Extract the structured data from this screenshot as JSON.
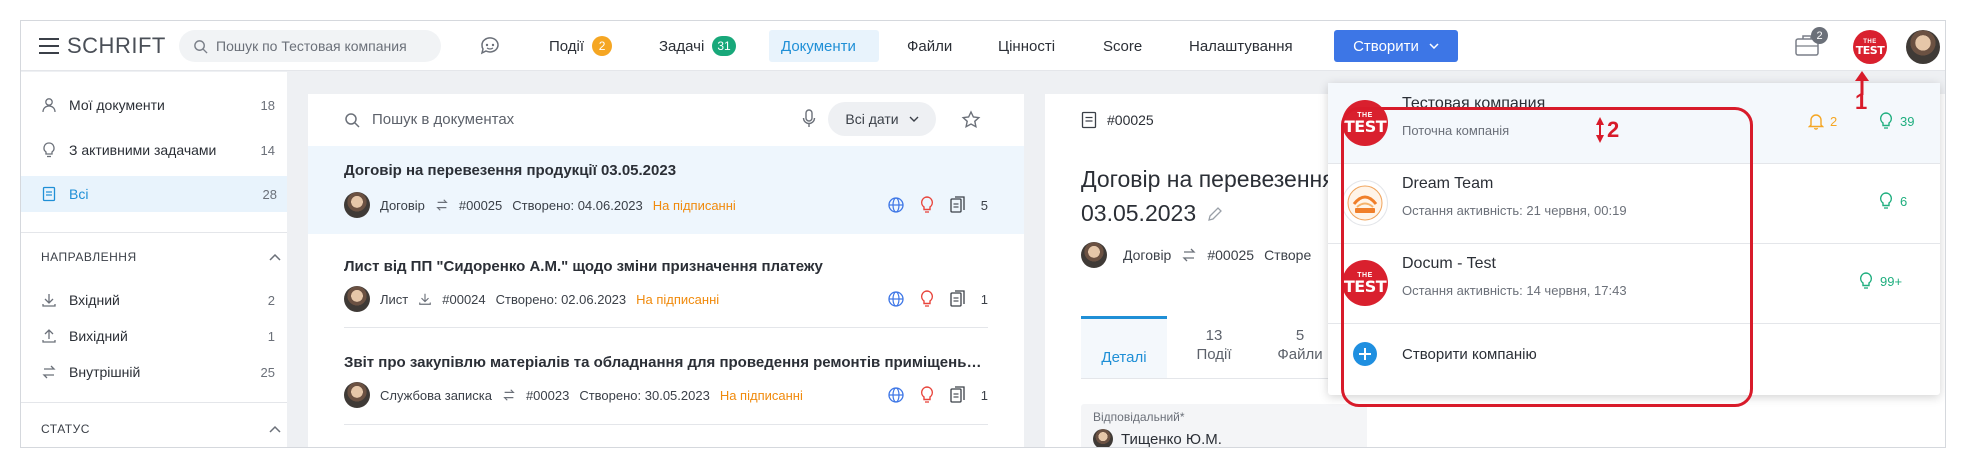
{
  "colors": {
    "accent": "#1f8fd6",
    "primary_button": "#3d76e6",
    "events_badge": "#f5a623",
    "tasks_badge": "#18a87a",
    "status_pending": "#f08a0c",
    "annotation": "#d81b2a",
    "bell": "#f5a623",
    "bulb": "#1eae7e"
  },
  "header": {
    "logo_text": "SCHRIFT",
    "search_placeholder": "Пошук по Тестовая компания",
    "nav": [
      {
        "label": "Події",
        "badge": "2",
        "active": false
      },
      {
        "label": "Задачі",
        "badge": "31",
        "active": false
      },
      {
        "label": "Документи",
        "badge": "",
        "active": true
      },
      {
        "label": "Файли",
        "badge": "",
        "active": false
      },
      {
        "label": "Цінності",
        "badge": "",
        "active": false
      },
      {
        "label": "Score",
        "badge": "",
        "active": false
      },
      {
        "label": "Налаштування",
        "badge": "",
        "active": false
      }
    ],
    "create_label": "Створити",
    "briefcase_badge": "2",
    "company_avatar_top": "THE",
    "company_avatar_main": "TEST"
  },
  "sidebar": {
    "items": [
      {
        "label": "Мої документи",
        "count": "18",
        "icon": "person-icon"
      },
      {
        "label": "З активними задачами",
        "count": "14",
        "icon": "bulb-icon"
      },
      {
        "label": "Всі",
        "count": "28",
        "icon": "document-icon"
      }
    ],
    "direction_heading": "НАПРАВЛЕННЯ",
    "direction_items": [
      {
        "label": "Вхідний",
        "count": "2",
        "icon": "download-icon"
      },
      {
        "label": "Вихідний",
        "count": "1",
        "icon": "upload-icon"
      },
      {
        "label": "Внутрішній",
        "count": "25",
        "icon": "swap-icon"
      }
    ],
    "status_heading": "СТАТУС"
  },
  "doclist": {
    "search_placeholder": "Пошук в документах",
    "date_filter": "Всі дати",
    "rows": [
      {
        "title": "Договір на перевезення продукції 03.05.2023",
        "type": "Договір",
        "number": "#00025",
        "created": "Створено: 04.06.2023",
        "status": "На підписанні",
        "files": "5"
      },
      {
        "title": "Лист від ПП \"Сидоренко А.М.\" щодо зміни призначення платежу",
        "type": "Лист",
        "number": "#00024",
        "created": "Створено: 02.06.2023",
        "status": "На підписанні",
        "files": "1"
      },
      {
        "title": "Звіт про закупівлю матеріалів та обладнання для проведення ремонтів приміщень …",
        "type": "Службова записка",
        "number": "#00023",
        "created": "Створено: 30.05.2023",
        "status": "На підписанні",
        "files": "1"
      }
    ]
  },
  "detail": {
    "number": "#00025",
    "title_line1": "Договір на перевезення",
    "title_line2": "03.05.2023",
    "type": "Договір",
    "doc_number": "#00025",
    "created_partial": "Створе",
    "tabs": [
      {
        "count": "",
        "label": "Деталі"
      },
      {
        "count": "13",
        "label": "Події"
      },
      {
        "count": "5",
        "label": "Файли"
      }
    ],
    "responsible_label": "Відповідальний*",
    "responsible_name": "Тищенко Ю.М."
  },
  "companies": {
    "items": [
      {
        "name": "Тестовая компания",
        "sub": "Поточна компанія",
        "bell": "2",
        "bulb": "39",
        "logo": "test"
      },
      {
        "name": "Dream Team",
        "sub": "Остання активність: 21 червня, 00:19",
        "bell": "",
        "bulb": "6",
        "logo": "dream"
      },
      {
        "name": "Docum - Test",
        "sub": "Остання активність: 14 червня, 17:43",
        "bell": "",
        "bulb": "99+",
        "logo": "test"
      }
    ],
    "create_label": "Створити компанію"
  },
  "annotations": {
    "one": "1",
    "two": "2"
  }
}
